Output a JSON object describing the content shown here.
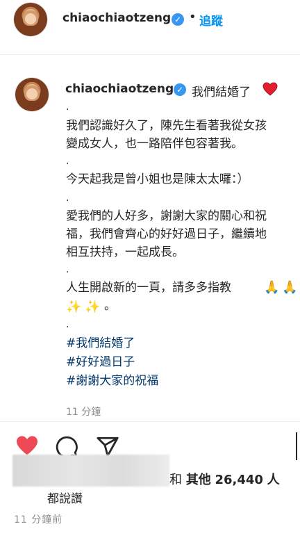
{
  "header": {
    "username": "chiaochiaotzeng",
    "separator": "•",
    "follow_label": "追蹤"
  },
  "caption": {
    "username": "chiaochiaotzeng",
    "title": "我們結婚了",
    "dot": ".",
    "line1": "我們認識好久了，陳先生看著我從女孩",
    "line2": "變成女人，也一路陪伴包容著我。",
    "line3": "今天起我是曾小姐也是陳太太囉：）",
    "line4": "愛我們的人好多，謝謝大家的關心和祝",
    "line5": "福，我們會齊心的好好過日子，繼續地",
    "line6": "相互扶持，一起成長。",
    "line7": "人生開啟新的一頁，請多多指教",
    "period": "。",
    "hashtags": [
      "#我們結婚了",
      "#好好過日子",
      "#謝謝大家的祝福"
    ],
    "time": "11 分鐘"
  },
  "icons": {
    "heart": "heart-emoji-icon",
    "hands": "folded-hands-icon",
    "sparkles": "sparkles-icon"
  },
  "likes": {
    "tail_char": "和",
    "others_label": "其他",
    "count": "26,440",
    "unit": "人",
    "line2": "都說讚"
  },
  "footer": {
    "time_ago": "11 分鐘前"
  },
  "colors": {
    "link": "#0095f6",
    "hashtag": "#00376b",
    "like_red": "#ed4956",
    "verified": "#3897f0",
    "muted": "#8e8e8e"
  }
}
